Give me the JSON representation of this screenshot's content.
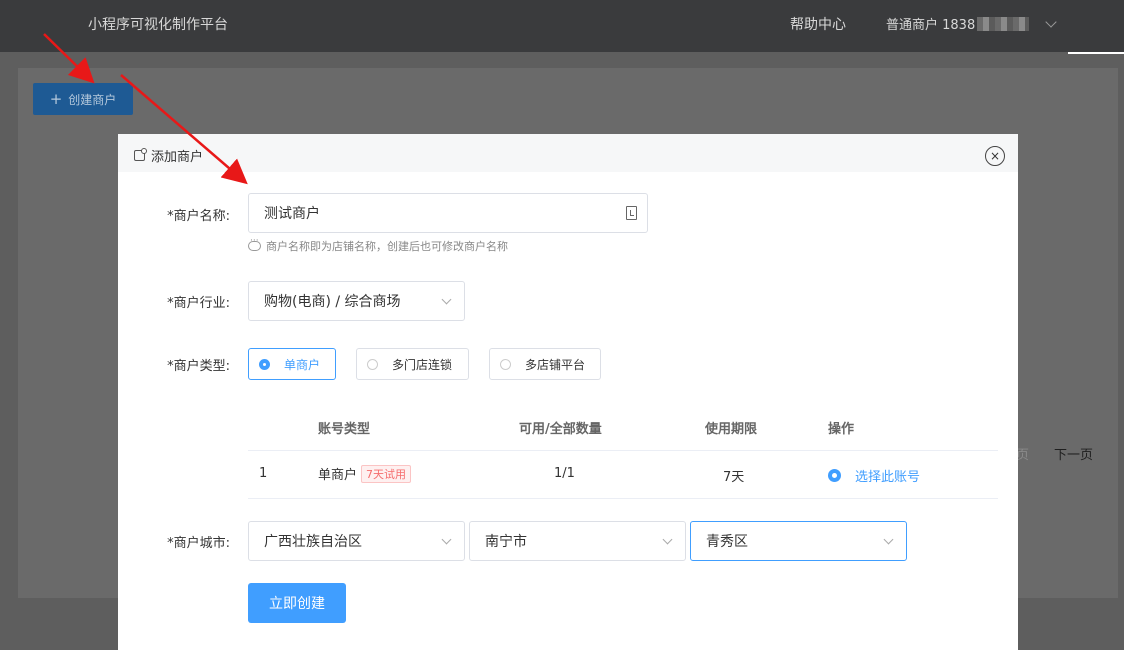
{
  "header": {
    "brand": "小程序可视化制作平台",
    "help": "帮助中心",
    "user_prefix": "普通商户 1838"
  },
  "page": {
    "create_button": "创建商户",
    "pager_prev": "页",
    "pager_next": "下一页"
  },
  "dialog": {
    "title": "添加商户",
    "close_glyph": "×",
    "name": {
      "label": "*商户名称:",
      "value": "测试商户",
      "hint": "商户名称即为店铺名称，创建后也可修改商户名称"
    },
    "industry": {
      "label": "*商户行业:",
      "value": "购物(电商) / 综合商场"
    },
    "type": {
      "label": "*商户类型:",
      "options": [
        "单商户",
        "多门店连锁",
        "多店铺平台"
      ],
      "selected": 0
    },
    "table": {
      "headers": [
        "账号类型",
        "可用/全部数量",
        "使用期限",
        "操作"
      ],
      "rows": [
        {
          "index": "1",
          "type": "单商户",
          "tag": "7天试用",
          "quantity": "1/1",
          "period": "7天",
          "action": "选择此账号"
        }
      ]
    },
    "city": {
      "label": "*商户城市:",
      "province": "广西壮族自治区",
      "city": "南宁市",
      "district": "青秀区"
    },
    "submit": "立即创建"
  },
  "colors": {
    "primary": "#409eff",
    "tag_red": "#f56c6c",
    "arrow": "#e81818"
  }
}
